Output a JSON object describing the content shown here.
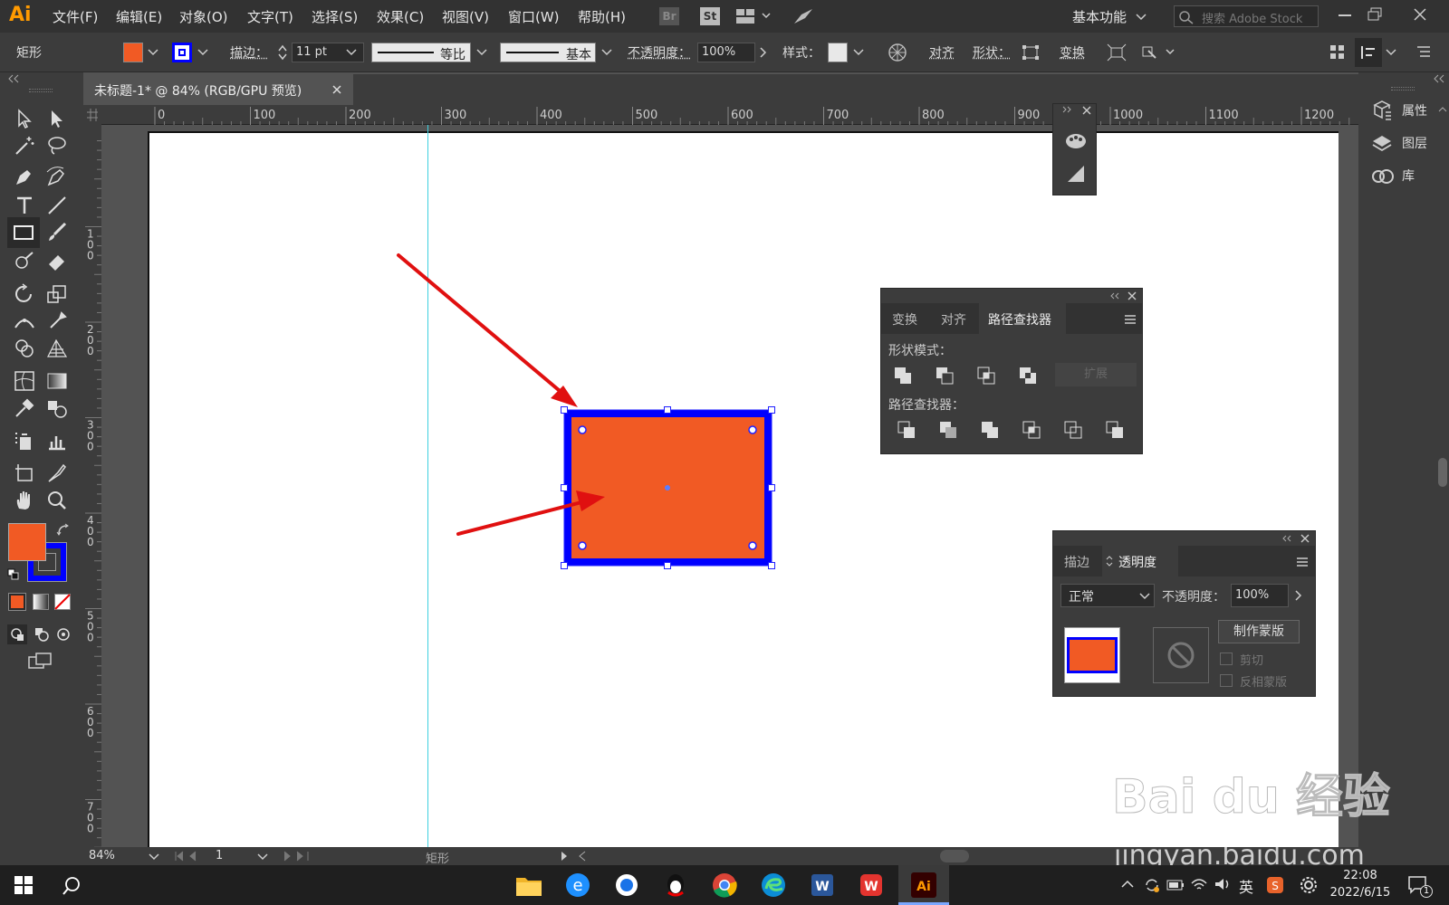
{
  "app": {
    "logo": "Ai"
  },
  "menu": [
    "文件(F)",
    "编辑(E)",
    "对象(O)",
    "文字(T)",
    "选择(S)",
    "效果(C)",
    "视图(V)",
    "窗口(W)",
    "帮助(H)"
  ],
  "menu_right": {
    "br": "Br",
    "st": "St",
    "workspace": "基本功能",
    "search_placeholder": "搜索 Adobe Stock"
  },
  "control": {
    "selection_label": "矩形",
    "stroke_label": "描边：",
    "stroke_weight": "11 pt",
    "profile_label": "等比",
    "brush_label": "基本",
    "opacity_label": "不透明度：",
    "opacity_value": "100%",
    "style_label": "样式：",
    "align_label": "对齐",
    "shape_label": "形状：",
    "transform_label": "变换"
  },
  "doc_tab": {
    "title": "未标题-1* @ 84% (RGB/GPU 预览)"
  },
  "ruler": {
    "h": [
      "0",
      "100",
      "200",
      "300",
      "400",
      "500",
      "600",
      "700",
      "800",
      "900",
      "1000",
      "1100",
      "1200"
    ],
    "v": [
      "1\n0\n0",
      "2\n0\n0",
      "3\n0\n0",
      "4\n0\n0",
      "5\n0\n0",
      "6\n0\n0",
      "7\n0\n0"
    ]
  },
  "colors": {
    "fill": "#f15a24",
    "stroke": "#0000ff",
    "arrow": "#e01010",
    "guide": "#3fd0e0"
  },
  "right_panel": {
    "items": [
      "属性",
      "图层",
      "库"
    ]
  },
  "pathfinder": {
    "tabs": [
      "变换",
      "对齐",
      "路径查找器"
    ],
    "shape_modes_label": "形状模式：",
    "expand_label": "扩展",
    "pathfinders_label": "路径查找器："
  },
  "transparency": {
    "tabs": [
      "描边",
      "透明度"
    ],
    "blend_mode": "正常",
    "opacity_label": "不透明度：",
    "opacity_value": "100%",
    "make_mask_label": "制作蒙版",
    "clip_label": "剪切",
    "invert_label": "反相蒙版"
  },
  "status": {
    "zoom": "84%",
    "page": "1",
    "tool": "矩形"
  },
  "taskbar": {
    "ime": "英",
    "time": "22:08",
    "date": "2022/6/15",
    "notif_count": "1"
  },
  "watermark": {
    "text": "Bai du 经验",
    "url": "jingyan.baidu.com"
  }
}
